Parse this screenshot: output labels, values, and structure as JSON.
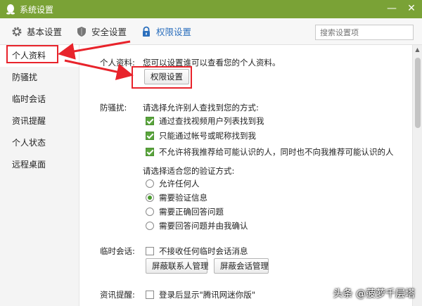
{
  "window": {
    "title": "系统设置",
    "minimize": "—",
    "close": "✕"
  },
  "toolbar": {
    "tabs": [
      {
        "label": "基本设置",
        "icon": "gear-icon"
      },
      {
        "label": "安全设置",
        "icon": "shield-icon"
      },
      {
        "label": "权限设置",
        "icon": "lock-icon",
        "active": true
      }
    ],
    "search_placeholder": "搜索设置项"
  },
  "sidebar": {
    "items": [
      {
        "label": "个人资料",
        "active": true
      },
      {
        "label": "防骚扰"
      },
      {
        "label": "临时会话"
      },
      {
        "label": "资讯提醒"
      },
      {
        "label": "个人状态"
      },
      {
        "label": "远程桌面"
      }
    ]
  },
  "profile": {
    "label": "个人资料:",
    "description": "您可以设置谁可以查看您的个人资料。",
    "button": "权限设置"
  },
  "anti_harass": {
    "label": "防骚扰:",
    "find_prompt": "请选择允许别人查找到您的方式:",
    "find_options": [
      {
        "label": "通过查找视频用户列表找到我",
        "checked": true
      },
      {
        "label": "只能通过帐号或昵称找到我",
        "checked": true
      },
      {
        "label": "不允许将我推荐给可能认识的人，同时也不向我推荐可能认识的人",
        "checked": true
      }
    ],
    "verify_prompt": "请选择适合您的验证方式:",
    "verify_options": [
      {
        "label": "允许任何人",
        "selected": false
      },
      {
        "label": "需要验证信息",
        "selected": true
      },
      {
        "label": "需要正确回答问题",
        "selected": false
      },
      {
        "label": "需要回答问题并由我确认",
        "selected": false
      }
    ]
  },
  "temp_session": {
    "label": "临时会话:",
    "option": {
      "label": "不接收任何临时会话消息",
      "checked": false
    },
    "buttons": [
      "屏蔽联系人管理",
      "屏蔽会话管理"
    ]
  },
  "news": {
    "label": "资讯提醒:",
    "option": {
      "label": "登录后显示\"腾讯网迷你版\"",
      "checked": false
    }
  },
  "watermark": "头条 @菠萝千层塔",
  "colors": {
    "titlebar": "#7aa236",
    "accent": "#2b6fbd",
    "highlight": "#e8232b",
    "check": "#5aa53d"
  }
}
